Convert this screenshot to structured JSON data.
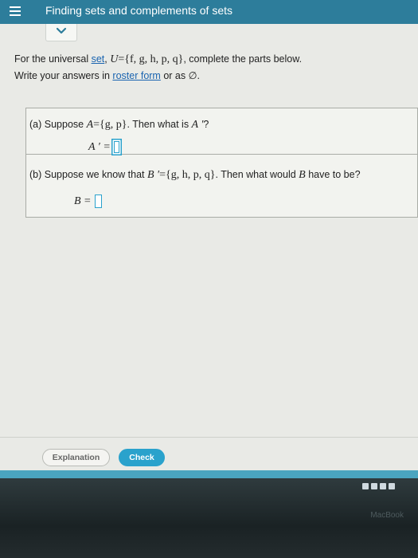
{
  "header": {
    "title": "Finding sets and complements of sets"
  },
  "intro": {
    "line1_prefix": "For the universal ",
    "set_link": "set",
    "line1_comma": ", ",
    "universe_var": "U",
    "universe_set": "={f, g, h, p, q}",
    "line1_suffix": ", complete the parts below.",
    "line2_prefix": "Write your answers in ",
    "roster_link": "roster form",
    "line2_suffix": " or as ∅."
  },
  "part_a": {
    "label": "(a) Suppose ",
    "var": "A",
    "set": "={g, p}",
    "question_end": ". Then what is ",
    "var_prime": "A ′",
    "qmark": "?",
    "answer_label": "A ′ ="
  },
  "part_b": {
    "label": "(b) Suppose we know that ",
    "var_prime": "B ′",
    "set": "={g, h, p, q}",
    "question_mid": ". Then what would ",
    "var": "B",
    "question_end": " have to be?",
    "answer_label": "B ="
  },
  "buttons": {
    "explanation": "Explanation",
    "check": "Check"
  },
  "bezel": {
    "label": "MacBook"
  },
  "colors": {
    "header_bg": "#2d7d9b",
    "accent": "#2aa2cc",
    "link": "#1a64b0"
  }
}
